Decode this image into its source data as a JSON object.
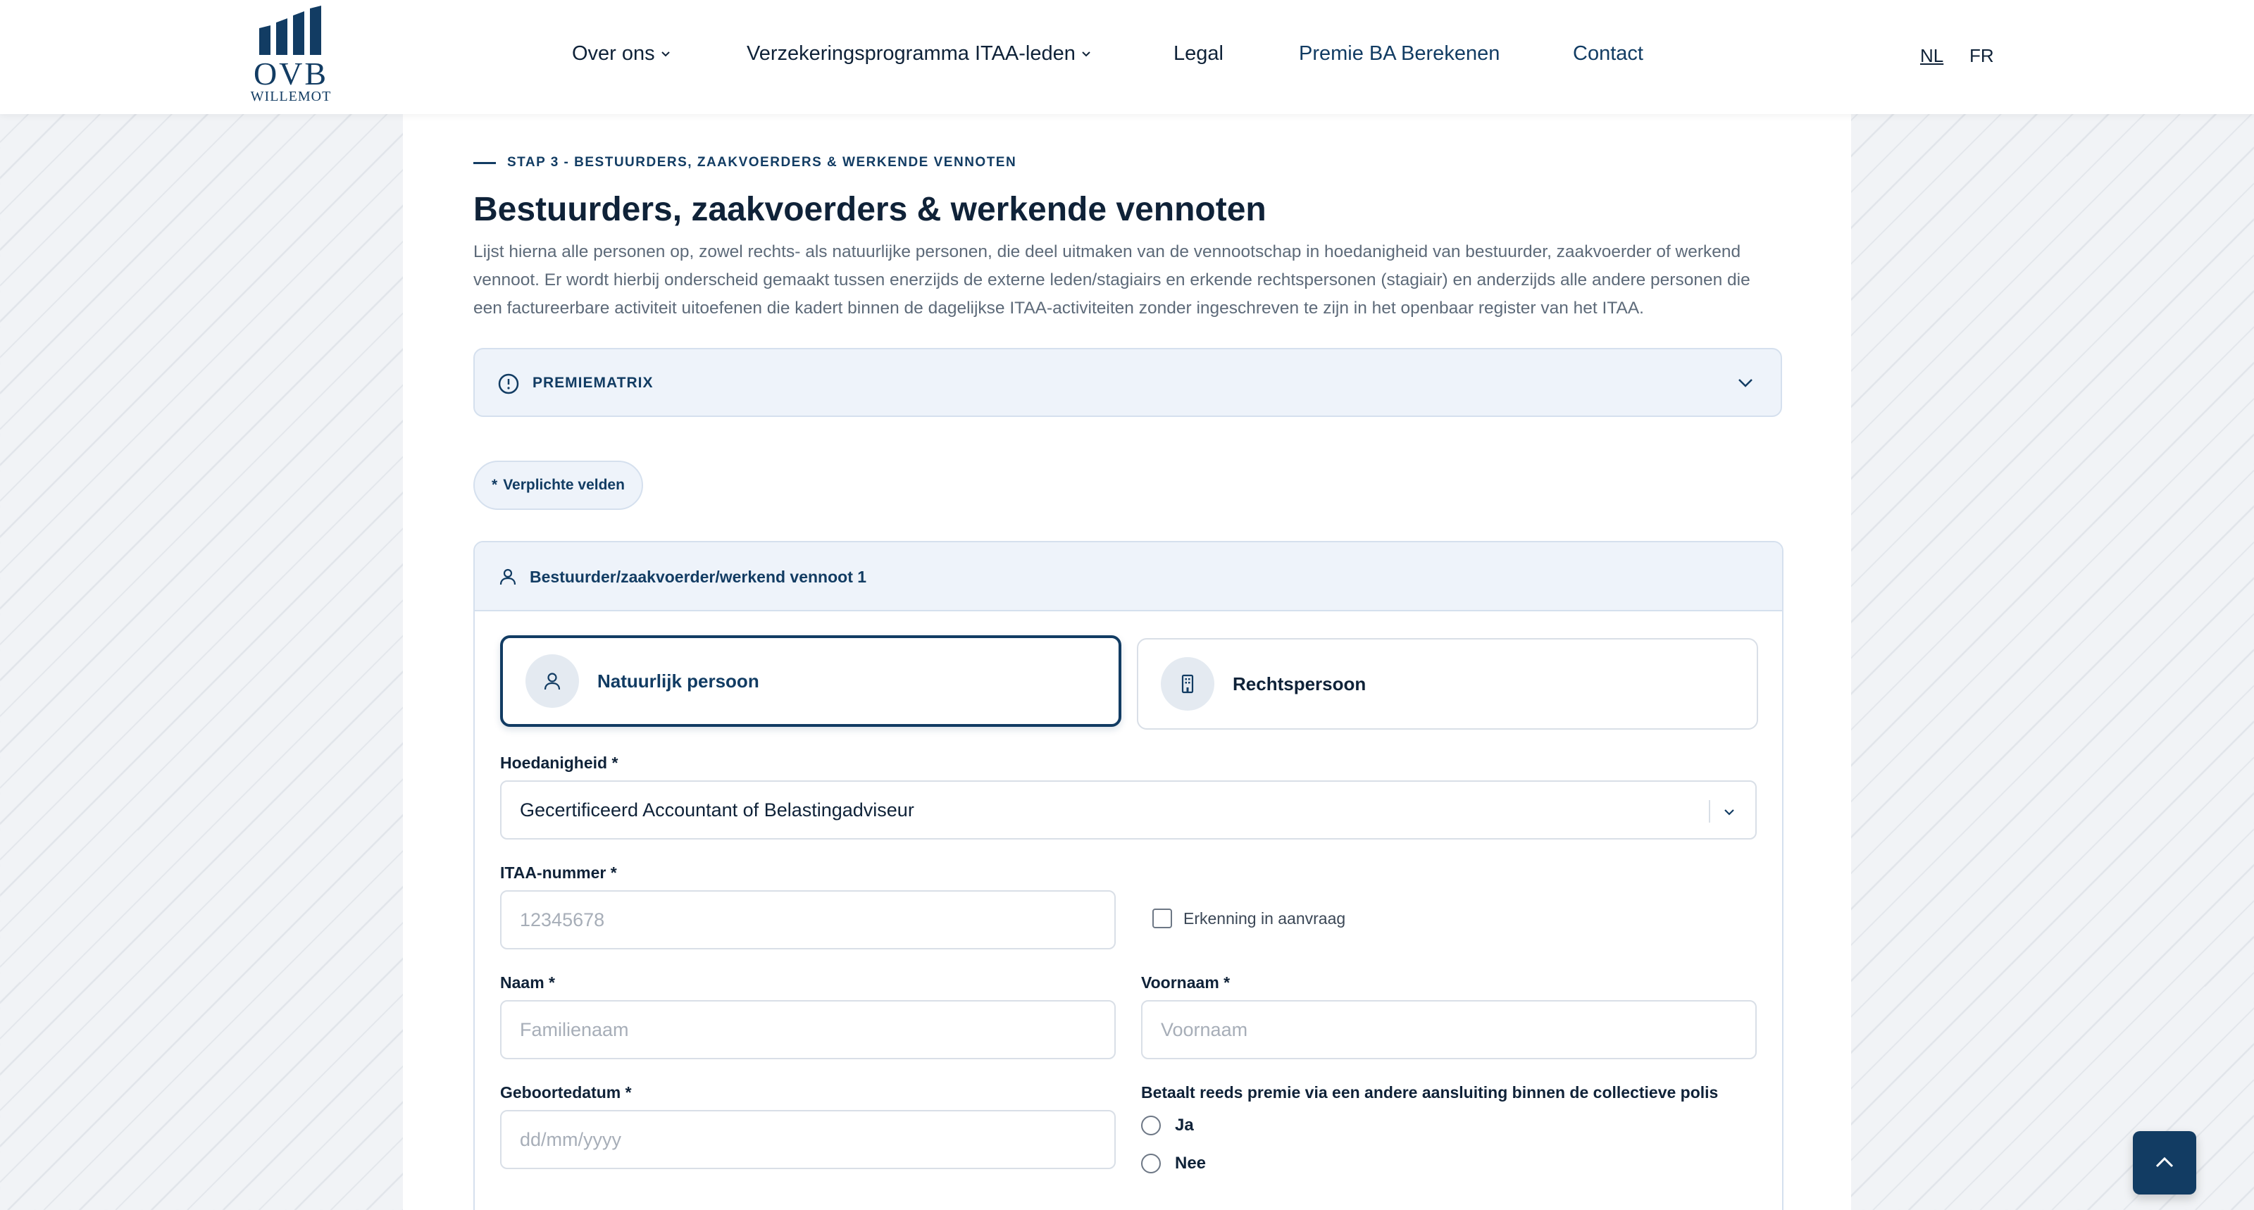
{
  "header": {
    "logo": {
      "brand": "OVB",
      "sub": "WILLEMOT"
    },
    "nav": [
      {
        "label": "Over ons",
        "has_dropdown": true
      },
      {
        "label": "Verzekeringsprogramma ITAA-leden",
        "has_dropdown": true
      },
      {
        "label": "Legal",
        "has_dropdown": false
      },
      {
        "label": "Premie BA Berekenen",
        "has_dropdown": false
      },
      {
        "label": "Contact",
        "has_dropdown": false
      }
    ],
    "languages": [
      {
        "code": "NL",
        "active": true
      },
      {
        "code": "FR",
        "active": false
      }
    ]
  },
  "page": {
    "step_label": "STAP 3 - BESTUURDERS, ZAAKVOERDERS & WERKENDE VENNOTEN",
    "title": "Bestuurders, zaakvoerders & werkende vennoten",
    "intro_lines": [
      "Lijst hierna alle personen op, zowel rechts- als natuurlijke personen, die deel uitmaken van de vennootschap in hoedanigheid van bestuurder, zaakvoerder of werkend",
      "vennoot. Er wordt hierbij onderscheid gemaakt tussen enerzijds de externe leden/stagiairs en erkende rechtspersonen (stagiair) en anderzijds alle andere personen die",
      "een factureerbare activiteit uitoefenen die kadert binnen de dagelijkse ITAA-activiteiten zonder ingeschreven te zijn in het openbaar register van het ITAA."
    ],
    "premiematrix_label": "PREMIEMATRIX",
    "required_badge": {
      "star": "*",
      "label": "Verplichte velden"
    }
  },
  "form": {
    "card_title": "Bestuurder/zaakvoerder/werkend vennoot 1",
    "person_types": [
      {
        "label": "Natuurlijk persoon",
        "icon": "person-icon",
        "selected": true
      },
      {
        "label": "Rechtspersoon",
        "icon": "building-icon",
        "selected": false
      }
    ],
    "hoedanigheid": {
      "label": "Hoedanigheid *",
      "value": "Gecertificeerd Accountant of Belastingadviseur"
    },
    "itaa": {
      "label": "ITAA-nummer *",
      "placeholder": "12345678",
      "value": ""
    },
    "erkenning": {
      "label": "Erkenning in aanvraag",
      "checked": false
    },
    "naam": {
      "label": "Naam *",
      "placeholder": "Familienaam",
      "value": ""
    },
    "voornaam": {
      "label": "Voornaam *",
      "placeholder": "Voornaam",
      "value": ""
    },
    "geboortedatum": {
      "label": "Geboortedatum *",
      "placeholder": "dd/mm/yyyy",
      "value": ""
    },
    "premie_question": {
      "label": "Betaalt reeds premie via een andere aansluiting binnen de collectieve polis",
      "options": [
        {
          "label": "Ja",
          "checked": false
        },
        {
          "label": "Nee",
          "checked": false
        }
      ]
    }
  },
  "colors": {
    "primary": "#123c63",
    "text": "#0f2238",
    "muted": "#5d6a79",
    "panel": "#eef3fa",
    "border": "#d5e0ee"
  }
}
